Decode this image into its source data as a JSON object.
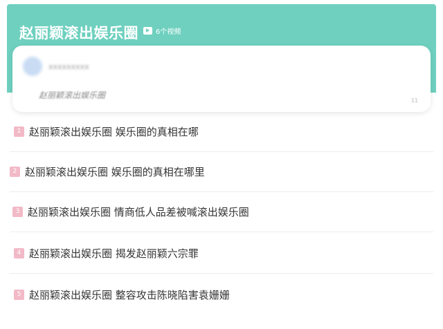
{
  "header": {
    "title": "赵丽颖滚出娱乐圈",
    "video_count": "6个视频"
  },
  "card": {
    "username": "xxxxxxxxx",
    "text": "赵丽颖滚出娱乐圈",
    "meta": "11"
  },
  "list": [
    {
      "rank": "1",
      "text": "赵丽颖滚出娱乐圈 娱乐圈的真相在哪"
    },
    {
      "rank": "2",
      "text": "赵丽颖滚出娱乐圈 娱乐圈的真相在哪里"
    },
    {
      "rank": "3",
      "text": "赵丽颖滚出娱乐圈 情商低人品差被喊滚出娱乐圈"
    },
    {
      "rank": "4",
      "text": "赵丽颖滚出娱乐圈 揭发赵丽颖六宗罪"
    },
    {
      "rank": "5",
      "text": "赵丽颖滚出娱乐圈 整容攻击陈晓陷害袁姗姗"
    }
  ],
  "colors": {
    "header_bg": "#6fd0bf",
    "rank_badge": "#f2b9c6"
  }
}
